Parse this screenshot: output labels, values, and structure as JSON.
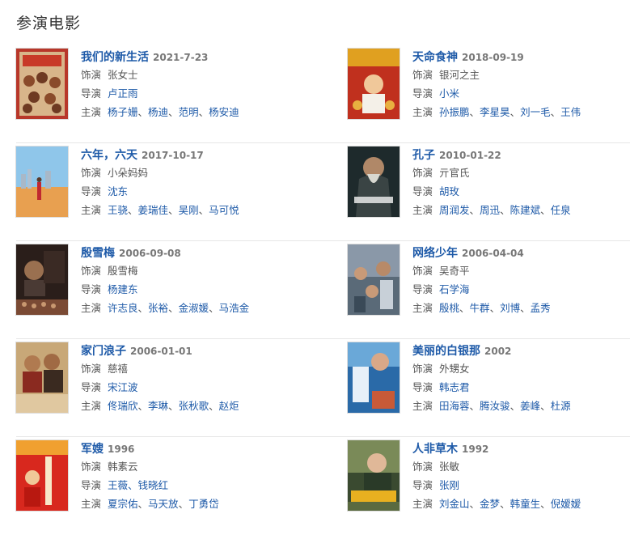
{
  "section_title": "参演电影",
  "labels": {
    "role": "饰演",
    "director": "导演",
    "cast": "主演"
  },
  "movies": [
    {
      "title": "我们的新生活",
      "date": "2021-7-23",
      "role": "张女士",
      "director": "卢正雨",
      "cast": [
        "杨子姗",
        "杨迪",
        "范明",
        "杨安迪"
      ]
    },
    {
      "title": "天命食神",
      "date": "2018-09-19",
      "role": "银河之主",
      "director": "小米",
      "cast": [
        "孙振鹏",
        "李星昊",
        "刘一毛",
        "王伟"
      ]
    },
    {
      "title": "六年，六天",
      "date": "2017-10-17",
      "role": "小朵妈妈",
      "director": "沈东",
      "cast": [
        "王骁",
        "姜瑞佳",
        "吴刚",
        "马可悦"
      ]
    },
    {
      "title": "孔子",
      "date": "2010-01-22",
      "role": "亓官氏",
      "director": "胡玫",
      "cast": [
        "周润发",
        "周迅",
        "陈建斌",
        "任泉"
      ]
    },
    {
      "title": "殷雪梅",
      "date": "2006-09-08",
      "role": "殷雪梅",
      "director": "杨建东",
      "cast": [
        "许志良",
        "张裕",
        "金淑媛",
        "马浩金"
      ]
    },
    {
      "title": "网络少年",
      "date": "2006-04-04",
      "role": "吴奇平",
      "director": "石学海",
      "cast": [
        "殷桃",
        "牛群",
        "刘博",
        "孟秀"
      ]
    },
    {
      "title": "家门浪子",
      "date": "2006-01-01",
      "role": "慈禧",
      "director": "宋江波",
      "cast": [
        "佟瑞欣",
        "李琳",
        "张秋歌",
        "赵炬"
      ]
    },
    {
      "title": "美丽的白银那",
      "date": "2002",
      "role": "外甥女",
      "director": "韩志君",
      "cast": [
        "田海蓉",
        "腾汝骏",
        "姜峰",
        "杜源"
      ]
    },
    {
      "title": "军嫂",
      "date": "1996",
      "role": "韩素云",
      "director": "王薇、钱晓红",
      "cast": [
        "夏宗佑",
        "马天放",
        "丁勇岱"
      ]
    },
    {
      "title": "人非草木",
      "date": "1992",
      "role": "张敏",
      "director": "张刚",
      "cast": [
        "刘金山",
        "金梦",
        "韩童生",
        "倪嫒嫒"
      ]
    }
  ]
}
